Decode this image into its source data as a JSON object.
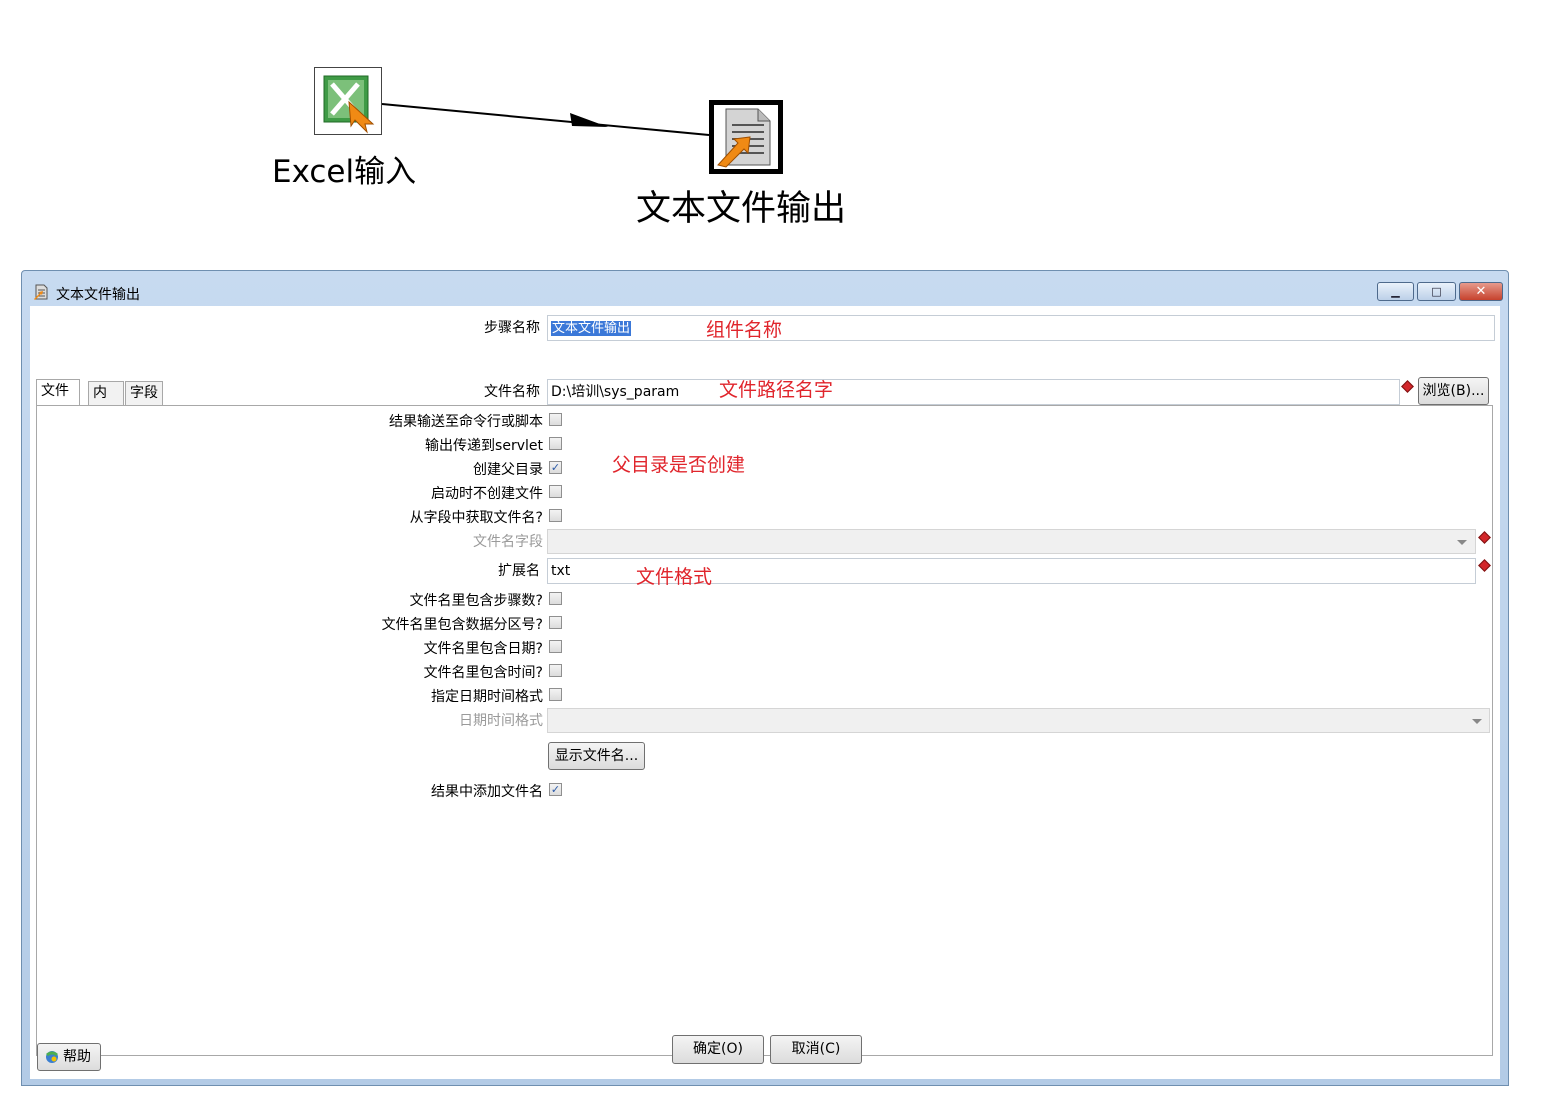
{
  "canvas": {
    "steps": [
      {
        "label": "Excel输入",
        "icon": "excel-input-icon"
      },
      {
        "label": "文本文件输出",
        "icon": "text-file-output-icon"
      }
    ]
  },
  "dialog": {
    "title": "文本文件输出",
    "window_buttons": {
      "minimize": "▁",
      "maximize": "□",
      "close": "✕"
    },
    "step_name_label": "步骤名称",
    "step_name_value": "文本文件输出",
    "tabs": [
      "文件",
      "内容",
      "字段"
    ],
    "active_tab": "文件",
    "fields": {
      "filename_label": "文件名称",
      "filename_value": "D:\\培训\\sys_param",
      "browse_button": "浏览(B)...",
      "pass_to_script_label": "结果输送至命令行或脚本",
      "pass_to_script_checked": false,
      "output_servlet_label": "输出传递到servlet",
      "output_servlet_checked": false,
      "create_parent_label": "创建父目录",
      "create_parent_checked": true,
      "no_create_on_start_label": "启动时不创建文件",
      "no_create_on_start_checked": false,
      "filename_from_field_label": "从字段中获取文件名?",
      "filename_from_field_checked": false,
      "filename_field_label": "文件名字段",
      "filename_field_value": "",
      "extension_label": "扩展名",
      "extension_value": "txt",
      "include_stepnr_label": "文件名里包含步骤数?",
      "include_stepnr_checked": false,
      "include_partnr_label": "文件名里包含数据分区号?",
      "include_partnr_checked": false,
      "include_date_label": "文件名里包含日期?",
      "include_date_checked": false,
      "include_time_label": "文件名里包含时间?",
      "include_time_checked": false,
      "specify_datetime_label": "指定日期时间格式",
      "specify_datetime_checked": false,
      "datetime_format_label": "日期时间格式",
      "datetime_format_value": "",
      "show_filename_button": "显示文件名...",
      "add_to_result_label": "结果中添加文件名",
      "add_to_result_checked": true
    },
    "annotations": {
      "component_name": "组件名称",
      "file_path": "文件路径名字",
      "create_parent": "父目录是否创建",
      "file_format": "文件格式"
    },
    "buttons": {
      "ok": "确定(O)",
      "cancel": "取消(C)",
      "help": "帮助"
    },
    "colors": {
      "annotation": "#e0252c",
      "titlebar": "#c7daf0",
      "selection": "#3b78d8"
    }
  }
}
